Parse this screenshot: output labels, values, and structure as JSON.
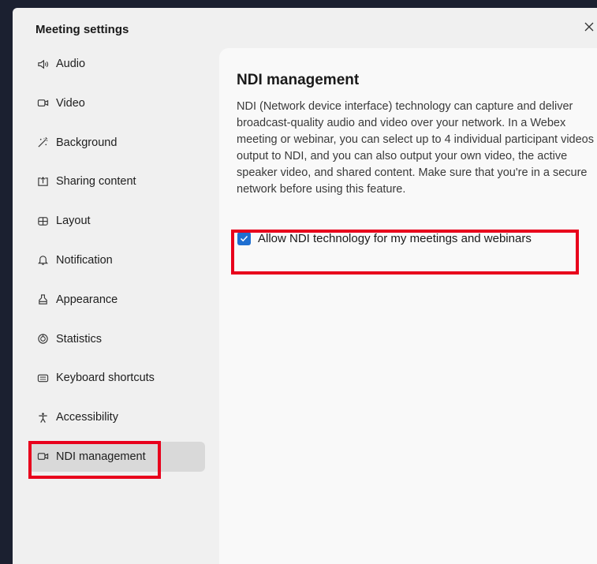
{
  "dialog": {
    "title": "Meeting settings",
    "close_icon": "close-icon"
  },
  "sidebar": {
    "items": [
      {
        "label": "Audio",
        "icon": "speaker-icon"
      },
      {
        "label": "Video",
        "icon": "video-camera-icon"
      },
      {
        "label": "Background",
        "icon": "background-wand-icon"
      },
      {
        "label": "Sharing content",
        "icon": "share-screen-icon"
      },
      {
        "label": "Layout",
        "icon": "layout-grid-icon"
      },
      {
        "label": "Notification",
        "icon": "bell-icon"
      },
      {
        "label": "Appearance",
        "icon": "appearance-icon"
      },
      {
        "label": "Statistics",
        "icon": "statistics-icon"
      },
      {
        "label": "Keyboard shortcuts",
        "icon": "keyboard-icon"
      },
      {
        "label": "Accessibility",
        "icon": "accessibility-icon"
      },
      {
        "label": "NDI management",
        "icon": "video-camera-icon",
        "active": true
      }
    ]
  },
  "content": {
    "title": "NDI management",
    "description": "NDI (Network device interface) technology can capture and deliver broadcast-quality audio and video over your network. In a Webex meeting or webinar, you can select up to 4 individual participant videos to output to NDI, and you can also output your own video, the active speaker video, and shared content. Make sure that you're in a secure network before using this feature.",
    "checkbox": {
      "label": "Allow NDI technology for my meetings and webinars",
      "checked": true
    }
  },
  "colors": {
    "highlight": "#e8001c",
    "checkbox": "#1f6fd1",
    "background": "#1b2030"
  }
}
